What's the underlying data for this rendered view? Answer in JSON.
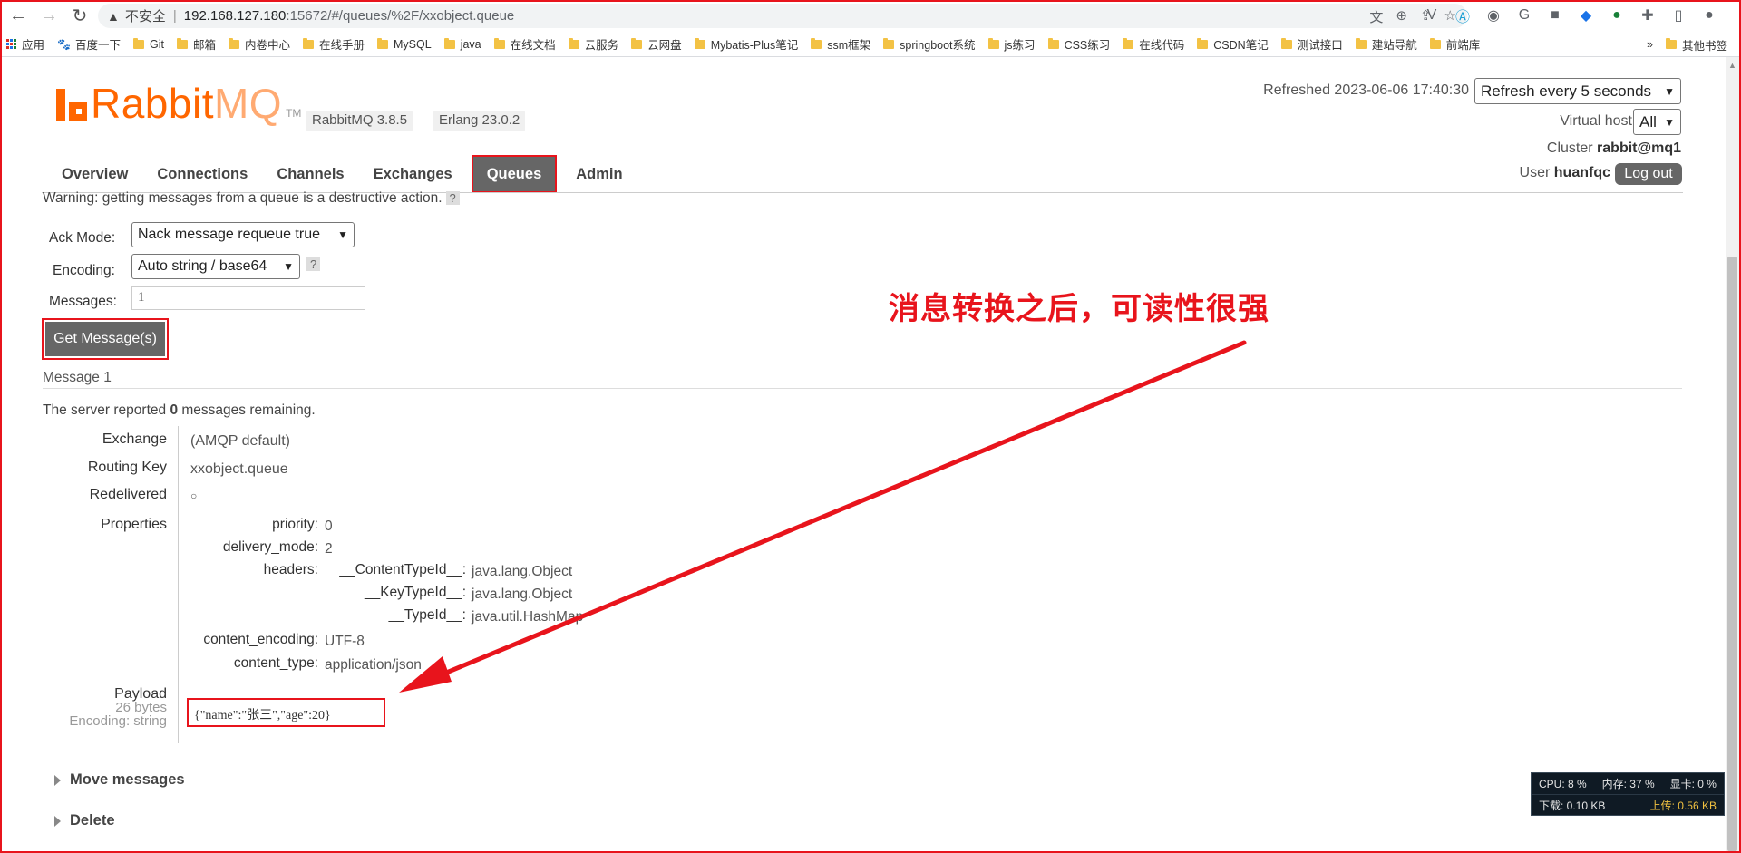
{
  "browser": {
    "insecure_label": "不安全",
    "url_host": "192.168.127.180",
    "url_rest": ":15672/#/queues/%2F/xxobject.queue",
    "bookmarks": [
      {
        "label": "应用",
        "icon": "apps-icon"
      },
      {
        "label": "百度一下",
        "icon": "baidu-icon"
      },
      {
        "label": "Git",
        "icon": "folder-icon"
      },
      {
        "label": "邮箱",
        "icon": "folder-icon"
      },
      {
        "label": "内卷中心",
        "icon": "folder-icon"
      },
      {
        "label": "在线手册",
        "icon": "folder-icon"
      },
      {
        "label": "MySQL",
        "icon": "folder-icon"
      },
      {
        "label": "java",
        "icon": "folder-icon"
      },
      {
        "label": "在线文档",
        "icon": "folder-icon"
      },
      {
        "label": "云服务",
        "icon": "folder-icon"
      },
      {
        "label": "云网盘",
        "icon": "folder-icon"
      },
      {
        "label": "Mybatis-Plus笔记",
        "icon": "folder-icon"
      },
      {
        "label": "ssm框架",
        "icon": "folder-icon"
      },
      {
        "label": "springboot系统",
        "icon": "folder-icon"
      },
      {
        "label": "js练习",
        "icon": "folder-icon"
      },
      {
        "label": "CSS练习",
        "icon": "folder-icon"
      },
      {
        "label": "在线代码",
        "icon": "folder-icon"
      },
      {
        "label": "CSDN笔记",
        "icon": "folder-icon"
      },
      {
        "label": "测试接口",
        "icon": "folder-icon"
      },
      {
        "label": "建站导航",
        "icon": "folder-icon"
      },
      {
        "label": "前端库",
        "icon": "folder-icon"
      }
    ],
    "more_bookmarks": "»",
    "other_bookmarks": "其他书签"
  },
  "header": {
    "logo_rabbit": "Rabbit",
    "logo_mq": "MQ",
    "logo_tm": "TM",
    "rabbitmq_version": "RabbitMQ 3.8.5",
    "erlang_version": "Erlang 23.0.2",
    "refreshed": "Refreshed 2023-06-06 17:40:30",
    "refresh_option": "Refresh every 5 seconds",
    "vhost_label": "Virtual host",
    "vhost_value": "All",
    "cluster_label": "Cluster",
    "cluster_value": "rabbit@mq1",
    "user_label": "User",
    "user_value": "huanfqc",
    "logout_label": "Log out"
  },
  "tabs": [
    {
      "label": "Overview",
      "active": false
    },
    {
      "label": "Connections",
      "active": false
    },
    {
      "label": "Channels",
      "active": false
    },
    {
      "label": "Exchanges",
      "active": false
    },
    {
      "label": "Queues",
      "active": true
    },
    {
      "label": "Admin",
      "active": false
    }
  ],
  "get_messages": {
    "warning": "Warning: getting messages from a queue is a destructive action.",
    "help": "?",
    "ack_mode_label": "Ack Mode:",
    "ack_mode_value": "Nack message requeue true",
    "encoding_label": "Encoding:",
    "encoding_value": "Auto string / base64",
    "messages_label": "Messages:",
    "messages_value": "1",
    "button_label": "Get Message(s)"
  },
  "message": {
    "heading": "Message 1",
    "remaining_prefix": "The server reported ",
    "remaining_count": "0",
    "remaining_suffix": " messages remaining.",
    "exchange_label": "Exchange",
    "exchange_value": "(AMQP default)",
    "routing_key_label": "Routing Key",
    "routing_key_value": "xxobject.queue",
    "redelivered_label": "Redelivered",
    "redelivered_value": "○",
    "properties_label": "Properties",
    "properties": {
      "priority_key": "priority:",
      "priority_val": "0",
      "delivery_mode_key": "delivery_mode:",
      "delivery_mode_val": "2",
      "headers_key": "headers:",
      "content_type_id_key": "__ContentTypeId__:",
      "content_type_id_val": "java.lang.Object",
      "key_type_id_key": "__KeyTypeId__:",
      "key_type_id_val": "java.lang.Object",
      "type_id_key": "__TypeId__:",
      "type_id_val": "java.util.HashMap",
      "content_encoding_key": "content_encoding:",
      "content_encoding_val": "UTF-8",
      "content_type_key": "content_type:",
      "content_type_val": "application/json"
    },
    "payload_label": "Payload",
    "payload_size": "26 bytes",
    "payload_encoding": "Encoding: string",
    "payload_value": "{\"name\":\"张三\",\"age\":20}"
  },
  "sections": {
    "move_messages": "Move messages",
    "delete": "Delete"
  },
  "annotation": {
    "text": "消息转换之后，可读性很强"
  },
  "monitor": {
    "cpu": "CPU: 8 %",
    "mem": "内存: 37 %",
    "gpu": "显卡: 0 %",
    "down": "下载: 0.10 KB",
    "up": "上传: 0.56 KB"
  },
  "colors": {
    "accent_orange": "#ff6600",
    "annotation_red": "#e8141c",
    "tab_active_bg": "#666666"
  }
}
